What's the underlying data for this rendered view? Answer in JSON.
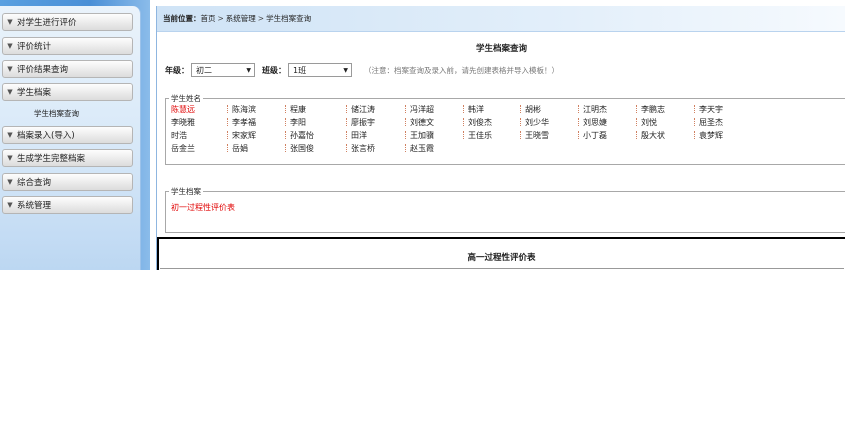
{
  "sidebar": {
    "items": [
      {
        "label": "对学生进行评价"
      },
      {
        "label": "评价统计"
      },
      {
        "label": "评价结果查询"
      },
      {
        "label": "学生档案"
      },
      {
        "label": "档案录入(导入)"
      },
      {
        "label": "生成学生完整档案"
      },
      {
        "label": "综合查询"
      },
      {
        "label": "系统管理"
      }
    ],
    "sub_item": "学生档案查询"
  },
  "breadcrumb": {
    "label": "当前位置：",
    "home": "首页",
    "sep": ">",
    "section": "系统管理",
    "page": "学生档案查询"
  },
  "page_title": "学生档案查询",
  "filters": {
    "grade_label": "年级：",
    "grade_value": "初二",
    "class_label": "班级：",
    "class_value": "1班",
    "note": "（注意：档案查询及录入前，请先创建表格并导入模板！）"
  },
  "names_box": {
    "legend": "学生姓名",
    "rows": [
      [
        "陈慧远",
        "陈海滨",
        "程康",
        "储江涛",
        "冯洋超",
        "韩洋",
        "胡彬",
        "江明杰",
        "李鹏志",
        "李天宇"
      ],
      [
        "李晓雅",
        "李孝福",
        "李阳",
        "廖振宇",
        "刘德文",
        "刘俊杰",
        "刘少华",
        "刘思婕",
        "刘悦",
        "屈圣杰"
      ],
      [
        "时浩",
        "宋家辉",
        "孙嘉怡",
        "田洋",
        "王加骥",
        "王佳乐",
        "王晓雪",
        "小丁磊",
        "殷大状",
        "袁梦辉"
      ],
      [
        "岳金兰",
        "岳娟",
        "张国俊",
        "张言桥",
        "赵玉霞"
      ]
    ],
    "highlight_color": "#e00000"
  },
  "record_box": {
    "legend": "学生档案",
    "link": "初一过程性评价表"
  },
  "report": {
    "title": "高一过程性评价表"
  },
  "colors": {
    "sidebar_blue": "#4a8fd6",
    "link_red": "#e00000"
  }
}
